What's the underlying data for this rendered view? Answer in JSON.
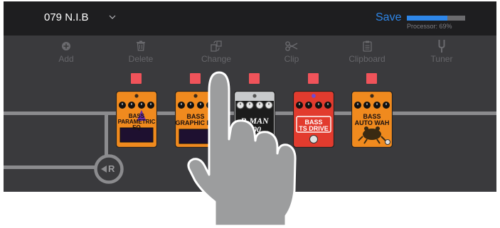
{
  "header": {
    "preset_name": "079 N.I.B",
    "save_label": "Save",
    "processor_label": "Processor: 69%",
    "processor_value": 0.69
  },
  "toolbar": [
    {
      "label": "Add",
      "icon": "plus-circle-icon"
    },
    {
      "label": "Delete",
      "icon": "trash-icon"
    },
    {
      "label": "Change",
      "icon": "swap-icon"
    },
    {
      "label": "Clip",
      "icon": "scissors-icon"
    },
    {
      "label": "Clipboard",
      "icon": "clipboard-icon"
    },
    {
      "label": "Tuner",
      "icon": "tuning-fork-icon"
    }
  ],
  "pedals": [
    {
      "name": "BASS\nPARAMETRIC EQ",
      "body_color": "#f08a1e"
    },
    {
      "name": "BASS\nGRAPHIC EQ",
      "body_color": "#f08a1e"
    },
    {
      "name": "B-MAN\n100",
      "body_color": "#c8cacc"
    },
    {
      "name": "BASS\nTS DRIVE",
      "body_color": "#e23b2e"
    },
    {
      "name": "BASS\nAUTO WAH",
      "body_color": "#f08a1e"
    }
  ],
  "return_label": "R",
  "colors": {
    "accent": "#2e86e8",
    "app_background": "#3a3a3d",
    "header_background": "#1e1e20",
    "effect_on_led": "#f0535a"
  }
}
